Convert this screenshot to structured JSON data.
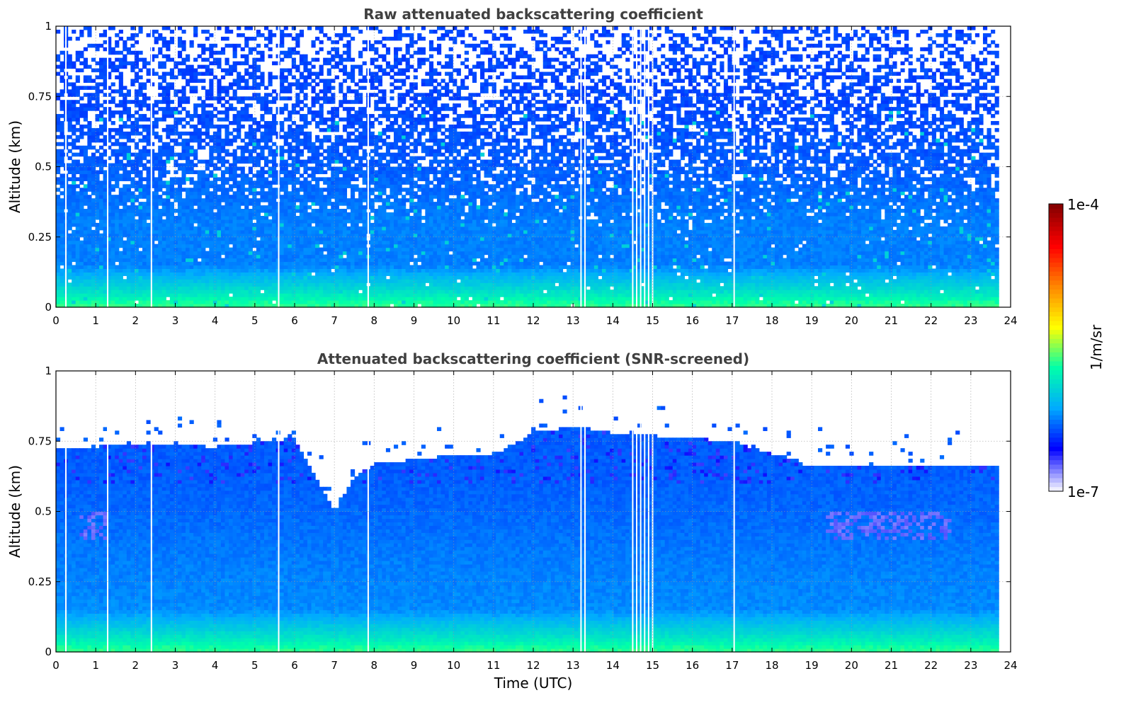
{
  "chart_data": [
    {
      "type": "heatmap",
      "title": "Raw attenuated backscattering coefficient",
      "xlabel": "",
      "ylabel": "Altitude (km)",
      "xlim": [
        0,
        24
      ],
      "ylim": [
        0,
        1
      ],
      "xticks": [
        "0",
        "1",
        "2",
        "3",
        "4",
        "5",
        "6",
        "7",
        "8",
        "9",
        "10",
        "11",
        "12",
        "13",
        "14",
        "15",
        "16",
        "17",
        "18",
        "19",
        "20",
        "21",
        "22",
        "23",
        "24"
      ],
      "yticks": [
        "0",
        "0.25",
        "0.5",
        "0.75",
        "1"
      ],
      "grid": true,
      "data_end_hour": 23.7,
      "missing_profile_hours": [
        0.25,
        1.3,
        2.4,
        5.6,
        7.85,
        13.2,
        13.3,
        14.5,
        14.6,
        14.7,
        14.8,
        14.9,
        15.0,
        17.05
      ],
      "levels": [
        {
          "altitude_km": 0.01,
          "intensity": 0.45
        },
        {
          "altitude_km": 0.04,
          "intensity": 0.4
        },
        {
          "altitude_km": 0.15,
          "intensity": 0.25
        },
        {
          "altitude_km": 0.3,
          "intensity": 0.25
        },
        {
          "altitude_km": 0.5,
          "intensity": 0.22
        },
        {
          "altitude_km": 0.75,
          "intensity": 0.2
        },
        {
          "altitude_km": 1.0,
          "intensity": 0.2
        }
      ]
    },
    {
      "type": "heatmap",
      "title": "Attenuated backscattering coefficient (SNR-screened)",
      "xlabel": "Time (UTC)",
      "ylabel": "Altitude (km)",
      "xlim": [
        0,
        24
      ],
      "ylim": [
        0,
        1
      ],
      "xticks": [
        "0",
        "1",
        "2",
        "3",
        "4",
        "5",
        "6",
        "7",
        "8",
        "9",
        "10",
        "11",
        "12",
        "13",
        "14",
        "15",
        "16",
        "17",
        "18",
        "19",
        "20",
        "21",
        "22",
        "23",
        "24"
      ],
      "yticks": [
        "0",
        "0.25",
        "0.5",
        "0.75",
        "1"
      ],
      "grid": true,
      "data_end_hour": 23.7,
      "missing_profile_hours": [
        0.25,
        1.3,
        2.4,
        5.6,
        7.85,
        13.2,
        13.3,
        14.5,
        14.6,
        14.7,
        14.8,
        14.9,
        15.0,
        17.05
      ],
      "screened_top_km": [
        {
          "hour": 0,
          "top": 0.72
        },
        {
          "hour": 2,
          "top": 0.74
        },
        {
          "hour": 4,
          "top": 0.73
        },
        {
          "hour": 6,
          "top": 0.76
        },
        {
          "hour": 7,
          "top": 0.5
        },
        {
          "hour": 7.5,
          "top": 0.62
        },
        {
          "hour": 8,
          "top": 0.67
        },
        {
          "hour": 10,
          "top": 0.7
        },
        {
          "hour": 11,
          "top": 0.7
        },
        {
          "hour": 12,
          "top": 0.78
        },
        {
          "hour": 13,
          "top": 0.8
        },
        {
          "hour": 14,
          "top": 0.78
        },
        {
          "hour": 15,
          "top": 0.77
        },
        {
          "hour": 17,
          "top": 0.75
        },
        {
          "hour": 19,
          "top": 0.66
        },
        {
          "hour": 21,
          "top": 0.66
        },
        {
          "hour": 23.7,
          "top": 0.66
        }
      ],
      "levels": [
        {
          "altitude_km": 0.01,
          "intensity": 0.45
        },
        {
          "altitude_km": 0.04,
          "intensity": 0.4
        },
        {
          "altitude_km": 0.15,
          "intensity": 0.26
        },
        {
          "altitude_km": 0.3,
          "intensity": 0.25
        },
        {
          "altitude_km": 0.5,
          "intensity": 0.23
        },
        {
          "altitude_km": 0.66,
          "intensity": 0.22
        }
      ]
    }
  ],
  "colorbar": {
    "label": "1/m/sr",
    "max_label": "1e-4",
    "min_label": "1e-7",
    "colormap": [
      "#eeeeff",
      "#0000ff",
      "#00aaff",
      "#00ffaa",
      "#ffff00",
      "#ff8800",
      "#ff0000",
      "#880000"
    ]
  }
}
